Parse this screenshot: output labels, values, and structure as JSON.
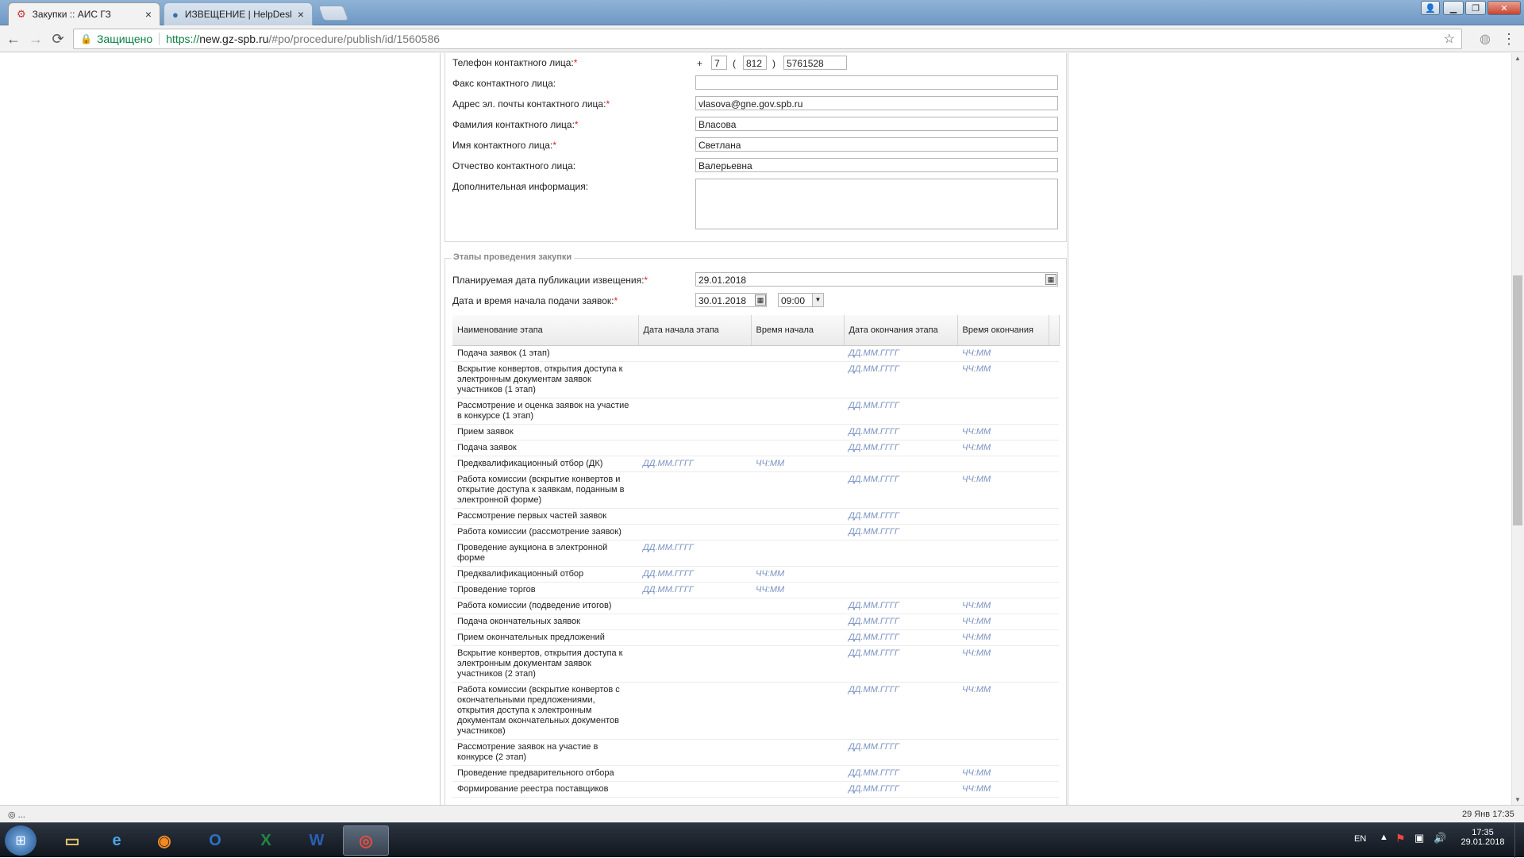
{
  "browser": {
    "tabs": [
      {
        "title": "Закупки :: АИС ГЗ",
        "active": true
      },
      {
        "title": "ИЗВЕЩЕНИЕ | HelpDesk",
        "active": false
      }
    ],
    "close_glyph": "×",
    "omnibox": {
      "secure_label": "Защищено",
      "url_scheme": "https://",
      "url_host": "new.gz-spb.ru",
      "url_path": "/#po/procedure/publish/id/1560586"
    },
    "icons": {
      "back": "←",
      "forward": "→",
      "reload": "⟳",
      "star": "☆",
      "menu": "⋮"
    }
  },
  "contact": {
    "phone": {
      "label": "Телефон контактного лица:",
      "plus": "+",
      "country": "7",
      "open": "(",
      "area": "812",
      "close": ")",
      "number": "5761528"
    },
    "fax": {
      "label": "Факс контактного лица:",
      "value": ""
    },
    "email": {
      "label": "Адрес эл. почты контактного лица:",
      "value": "vlasova@gne.gov.spb.ru"
    },
    "surname": {
      "label": "Фамилия контактного лица:",
      "value": "Власова"
    },
    "name": {
      "label": "Имя контактного лица:",
      "value": "Светлана"
    },
    "patronymic": {
      "label": "Отчество контактного лица:",
      "value": "Валерьевна"
    },
    "extra": {
      "label": "Дополнительная информация:",
      "value": ""
    },
    "required_mark": "*"
  },
  "stages": {
    "legend": "Этапы проведения закупки",
    "publish_date": {
      "label": "Планируемая дата публикации извещения:",
      "value": "29.01.2018"
    },
    "start": {
      "label": "Дата и время начала подачи заявок:",
      "date": "30.01.2018",
      "time": "09:00"
    },
    "columns": [
      "Наименование этапа",
      "Дата начала этапа",
      "Время начала",
      "Дата окончания этапа",
      "Время окончания"
    ],
    "rows": [
      [
        "Подача заявок (1 этап)",
        "",
        "",
        "ДД.ММ.ГГГГ",
        "ЧЧ:ММ"
      ],
      [
        "Вскрытие конвертов, открытия доступа к электронным документам заявок участников (1 этап)",
        "",
        "",
        "ДД.ММ.ГГГГ",
        "ЧЧ:ММ"
      ],
      [
        "Рассмотрение и оценка заявок на участие в конкурсе (1 этап)",
        "",
        "",
        "ДД.ММ.ГГГГ",
        ""
      ],
      [
        "Прием заявок",
        "",
        "",
        "ДД.ММ.ГГГГ",
        "ЧЧ:ММ"
      ],
      [
        "Подача заявок",
        "",
        "",
        "ДД.ММ.ГГГГ",
        "ЧЧ:ММ"
      ],
      [
        "Предквалификационный отбор (ДК)",
        "ДД.ММ.ГГГГ",
        "ЧЧ:ММ",
        "",
        ""
      ],
      [
        "Работа комиссии (вскрытие конвертов и открытие доступа к заявкам, поданным в электронной форме)",
        "",
        "",
        "ДД.ММ.ГГГГ",
        "ЧЧ:ММ"
      ],
      [
        "Рассмотрение первых частей заявок",
        "",
        "",
        "ДД.ММ.ГГГГ",
        ""
      ],
      [
        "Работа комиссии (рассмотрение заявок)",
        "",
        "",
        "ДД.ММ.ГГГГ",
        ""
      ],
      [
        "Проведение аукциона в электронной форме",
        "ДД.ММ.ГГГГ",
        "",
        "",
        ""
      ],
      [
        "Предквалификационный отбор",
        "ДД.ММ.ГГГГ",
        "ЧЧ:ММ",
        "",
        ""
      ],
      [
        "Проведение торгов",
        "ДД.ММ.ГГГГ",
        "ЧЧ:ММ",
        "",
        ""
      ],
      [
        "Работа комиссии (подведение итогов)",
        "",
        "",
        "ДД.ММ.ГГГГ",
        "ЧЧ:ММ"
      ],
      [
        "Подача окончательных заявок",
        "",
        "",
        "ДД.ММ.ГГГГ",
        "ЧЧ:ММ"
      ],
      [
        "Прием окончательных предложений",
        "",
        "",
        "ДД.ММ.ГГГГ",
        "ЧЧ:ММ"
      ],
      [
        "Вскрытие конвертов, открытия доступа к электронным документам заявок участников (2 этап)",
        "",
        "",
        "ДД.ММ.ГГГГ",
        "ЧЧ:ММ"
      ],
      [
        "Работа комиссии (вскрытие конвертов с окончательными предложениями, открытия доступа к электронным документам окончательных документов участников)",
        "",
        "",
        "ДД.ММ.ГГГГ",
        "ЧЧ:ММ"
      ],
      [
        "Рассмотрение заявок на участие в конкурсе (2 этап)",
        "",
        "",
        "ДД.ММ.ГГГГ",
        ""
      ],
      [
        "Проведение предварительного отбора",
        "",
        "",
        "ДД.ММ.ГГГГ",
        "ЧЧ:ММ"
      ],
      [
        "Формирование реестра поставщиков",
        "",
        "",
        "ДД.ММ.ГГГГ",
        "ЧЧ:ММ"
      ]
    ]
  },
  "statusbar": {
    "left": "◎ ...",
    "right": "29 Янв 17:35"
  },
  "taskbar": {
    "apps": [
      {
        "name": "explorer",
        "glyph": "▭",
        "color": "#e8c76a"
      },
      {
        "name": "ie",
        "glyph": "e",
        "color": "#4aa3e8"
      },
      {
        "name": "firefox",
        "glyph": "◉",
        "color": "#f08a24"
      },
      {
        "name": "outlook",
        "glyph": "O",
        "color": "#2f6fc4"
      },
      {
        "name": "excel",
        "glyph": "X",
        "color": "#1f8a45"
      },
      {
        "name": "word",
        "glyph": "W",
        "color": "#2b5fb4"
      },
      {
        "name": "chrome",
        "glyph": "◎",
        "color": "#e84c3d"
      }
    ],
    "lang": "EN",
    "time": "17:35",
    "date": "29.01.2018"
  }
}
